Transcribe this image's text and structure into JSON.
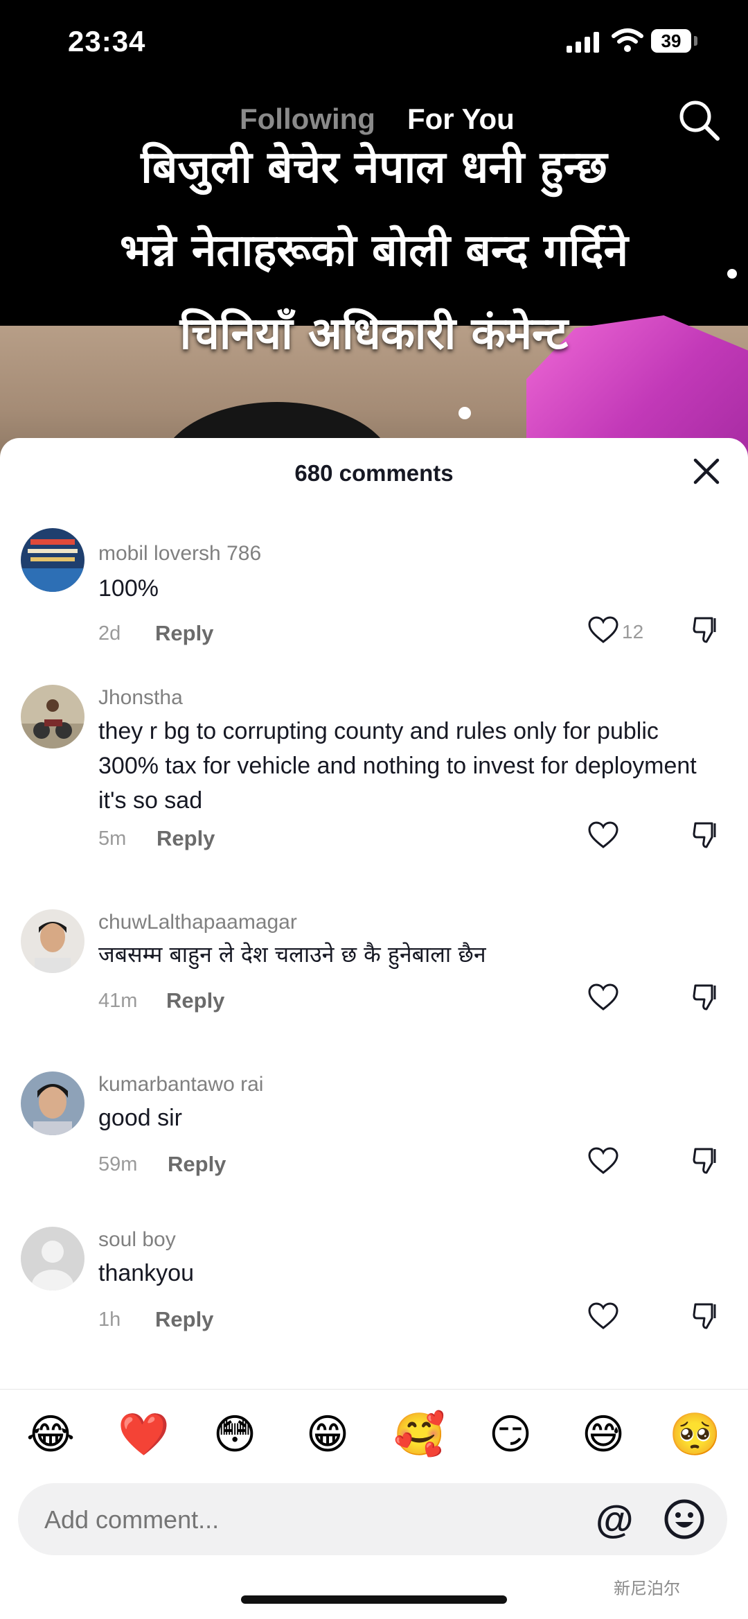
{
  "status_bar": {
    "time": "23:34",
    "battery": "39"
  },
  "feed_tabs": {
    "following": "Following",
    "for_you": "For You"
  },
  "caption": {
    "line1": "बिजुली बेचेर नेपाल धनी हुन्छ",
    "line2": "भन्ने नेताहरूको बोली बन्द गर्दिने",
    "line3": "चिनियाँ अधिकारी कंमेन्ट"
  },
  "comments_sheet": {
    "title": "680 comments",
    "reply_label": "Reply",
    "comments": [
      {
        "user": "mobil loversh 786",
        "text": "100%",
        "time": "2d",
        "likes": "12"
      },
      {
        "user": "Jhonstha",
        "text": "they r bg to corrupting county and rules only for public 300% tax for vehicle and nothing to invest for deployment it's so sad",
        "time": "5m",
        "likes": ""
      },
      {
        "user": "chuwLalthapaamagar",
        "text": "जबसम्म बाहुन ले देश चलाउने छ कै हुनेबाला छैन",
        "time": "41m",
        "likes": ""
      },
      {
        "user": "kumarbantawo rai",
        "text": "good sir",
        "time": "59m",
        "likes": ""
      },
      {
        "user": "soul boy",
        "text": "thankyou",
        "time": "1h",
        "likes": ""
      }
    ]
  },
  "emoji_bar": [
    "😂",
    "❤️",
    "😳",
    "😁",
    "🥰",
    "😏",
    "😅",
    "🥺"
  ],
  "comment_input": {
    "placeholder": "Add comment...",
    "mention": "@"
  },
  "watermark": "新尼泊尔",
  "colors": {
    "text_primary": "#161823",
    "text_secondary": "#808080",
    "sheet_bg": "#ffffff",
    "input_bg": "#f1f1f2"
  },
  "icons": [
    "search-icon",
    "close-icon",
    "heart-icon",
    "dislike-icon",
    "emoji-face-icon",
    "signal-icon",
    "wifi-icon",
    "battery-icon"
  ]
}
